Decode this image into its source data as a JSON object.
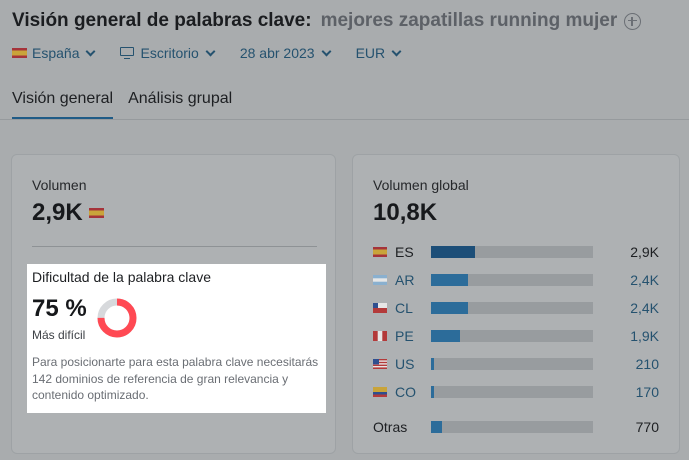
{
  "header": {
    "title": "Visión general de palabras clave:",
    "keyword": "mejores zapatillas running mujer",
    "add_icon": "plus-circle-icon"
  },
  "filters": {
    "country": "España",
    "device": "Escritorio",
    "date": "28 abr 2023",
    "currency": "EUR"
  },
  "tabs": [
    {
      "label": "Visión general",
      "active": true
    },
    {
      "label": "Análisis grupal",
      "active": false
    }
  ],
  "volume": {
    "label": "Volumen",
    "value": "2,9K"
  },
  "keyword_difficulty": {
    "title": "Dificultad de la palabra clave",
    "value": "75 %",
    "level": "Más difícil",
    "percent": 75,
    "color": "#ff4953",
    "description": "Para posicionarte para esta palabra clave necesitarás 142 dominios de referencia de gran relevancia y contenido optimizado."
  },
  "global_volume": {
    "label": "Volumen global",
    "value": "10,8K",
    "countries": [
      {
        "code": "ES",
        "value": "2,9K",
        "share": 0.27,
        "link": false
      },
      {
        "code": "AR",
        "value": "2,4K",
        "share": 0.23,
        "link": true
      },
      {
        "code": "CL",
        "value": "2,4K",
        "share": 0.23,
        "link": true
      },
      {
        "code": "PE",
        "value": "1,9K",
        "share": 0.18,
        "link": true
      },
      {
        "code": "US",
        "value": "210",
        "share": 0.02,
        "link": true
      },
      {
        "code": "CO",
        "value": "170",
        "share": 0.016,
        "link": true
      }
    ],
    "other": {
      "label": "Otras",
      "value": "770",
      "share": 0.07
    }
  }
}
